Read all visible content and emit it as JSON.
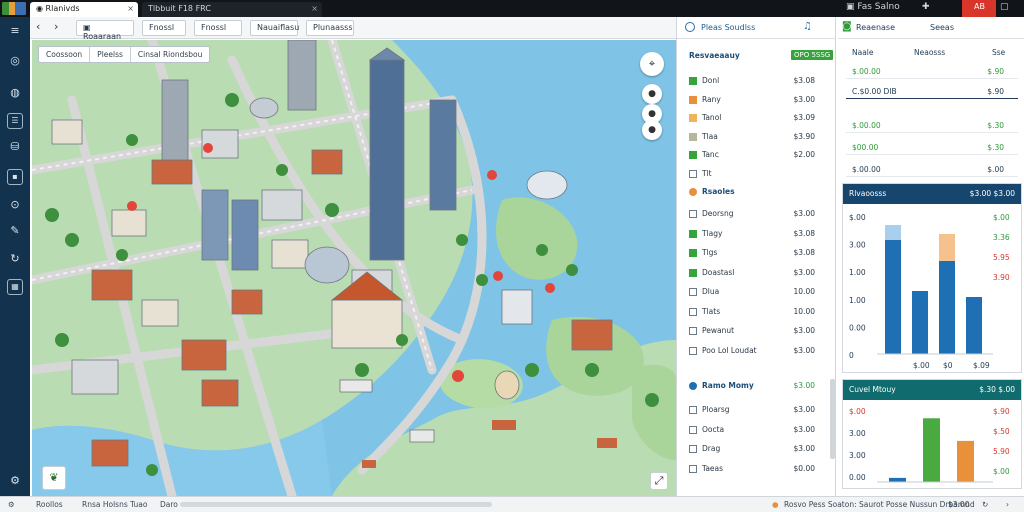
{
  "topbar": {
    "tabs": [
      "Rlanivds",
      "Tlbbuit F18 FRC",
      "Fas Salno",
      "AB"
    ],
    "close": "×"
  },
  "nav": {
    "back": "‹",
    "forward": "›",
    "tabs": [
      "Roaaraan",
      "Fnossl",
      "Nauaiflasu",
      "Plunaasss"
    ]
  },
  "map": {
    "subtabs": [
      "Coossoon",
      "Pleelss",
      "Cinsal Riondsbou"
    ],
    "controls": [
      "⌖",
      "●",
      "●",
      "●"
    ]
  },
  "layers": {
    "title": "Pleas Soudlss",
    "header": {
      "label": "Resvaeaauy",
      "badge": "OPO 5SSG"
    },
    "items": [
      {
        "label": "Donl",
        "value": "$3.08",
        "color": "#36a33b"
      },
      {
        "label": "Rany",
        "value": "$3.00",
        "color": "#e8913a"
      },
      {
        "label": "Tanol",
        "value": "$3.09",
        "color": "#f0b25a"
      },
      {
        "label": "Tlaa",
        "value": "$3.90",
        "color": "#b9b49c"
      },
      {
        "label": "Tanc",
        "value": "$2.00",
        "color": "#36a33b"
      },
      {
        "label": "Tlt",
        "value": "",
        "color": "#ffffff"
      }
    ],
    "group2": {
      "label": "Rsaoles",
      "color": "#e8913a"
    },
    "items2": [
      {
        "label": "Deorsng",
        "value": "$3.00",
        "color": "#ffffff"
      },
      {
        "label": "Tlagy",
        "value": "$3.08",
        "color": "#36a33b"
      },
      {
        "label": "Tlgs",
        "value": "$3.08",
        "color": "#36a33b"
      },
      {
        "label": "Doastasl",
        "value": "$3.00",
        "color": "#36a33b"
      },
      {
        "label": "Dlua",
        "value": "10.00",
        "color": "#ffffff"
      },
      {
        "label": "Tlats",
        "value": "10.00",
        "color": "#ffffff"
      },
      {
        "label": "Pewanut",
        "value": "$3.00",
        "color": "#ffffff"
      },
      {
        "label": "Poo Lol Loudat",
        "value": "$3.00",
        "color": "#ffffff"
      }
    ],
    "group3": {
      "label": "Ramo Momy",
      "value": "$3.00"
    },
    "items3": [
      {
        "label": "Ploarsg",
        "value": "$3.00"
      },
      {
        "label": "Oocta",
        "value": "$3.00"
      },
      {
        "label": "Drag",
        "value": "$3.00"
      },
      {
        "label": "Taeas",
        "value": "$0.00"
      }
    ]
  },
  "rpanel": {
    "title": "Reaenase",
    "tab": "Seeas",
    "colheads": [
      "Naale",
      "Neaosss",
      "Sse"
    ],
    "rows": [
      {
        "a": "$.00.00",
        "b": "$.90",
        "color": "#2e9a3a"
      },
      {
        "a": "C.$0.00 DIB",
        "b": "$.90",
        "color": "#1f3b55"
      },
      {
        "a": "$.00.00",
        "b": "$.30",
        "color": "#2e9a3a"
      },
      {
        "a": "$00.00",
        "b": "$.30",
        "color": "#2e9a3a"
      },
      {
        "a": "$.00.00",
        "b": "$.00",
        "color": "#1f3b55"
      }
    ],
    "card1": {
      "title": "Rlvaoosss",
      "right": "$3.00 $3.00",
      "color": "#16466e",
      "yticks": [
        "$.00",
        "3.00",
        "1.00",
        "1.00",
        "0.00",
        "0"
      ],
      "rticks": [
        "$.00",
        "3.36",
        "5.95",
        "3.90"
      ],
      "xticks": [
        "$.00",
        "$0",
        "$.09"
      ]
    },
    "card2": {
      "title": "Cuvel Mtouy",
      "right": "$.30 $.00",
      "color": "#0f6b6e",
      "yticks": [
        "$.00",
        "3.00",
        "3.00",
        "0.00"
      ],
      "rticks": [
        "$.90",
        "$.50",
        "5.90",
        "$.00"
      ]
    }
  },
  "chart_data": [
    {
      "type": "bar",
      "categories": [
        "1",
        "2",
        "3",
        "4"
      ],
      "series": [
        {
          "values": [
            1.9,
            1.05,
            1.55,
            0.95
          ],
          "color": "#1f6fb4"
        },
        {
          "values": [
            0.25,
            0,
            0.45,
            0
          ],
          "color": "#a8d0ee"
        }
      ],
      "ylim": [
        0,
        2.3
      ]
    },
    {
      "type": "bar",
      "categories": [
        "1",
        "2",
        "3"
      ],
      "values": [
        0.2,
        3.1,
        2.0
      ],
      "colors": [
        "#1f6fb4",
        "#4aaa3f",
        "#e8913a"
      ],
      "ylim": [
        0,
        3.6
      ]
    }
  ],
  "status": {
    "left": [
      "Roollos",
      "Rnsa Holsns  Tuao",
      "Daro"
    ],
    "right": "Rosvo Pess Soaton: Saurot Posse Nussun Drbamnd",
    "far": "$3.00"
  }
}
